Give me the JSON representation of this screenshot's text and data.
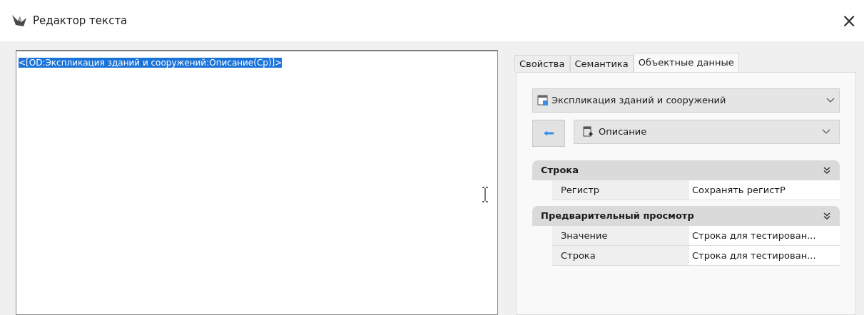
{
  "window": {
    "title": "Редактор текста",
    "close": "×"
  },
  "editor": {
    "text": "<[OD:Экспликация зданий и сооружений:Описание(Ср)]>",
    "selected": true
  },
  "tabs": [
    {
      "label": "Свойства",
      "selected": false
    },
    {
      "label": "Семантика",
      "selected": false
    },
    {
      "label": "Объектные данные",
      "selected": true
    }
  ],
  "table_combo": {
    "value": "Экспликация зданий и сооружений"
  },
  "field_combo": {
    "value": "Описание"
  },
  "groups": [
    {
      "title": "Строка",
      "expanded": true,
      "rows": [
        {
          "name": "Регистр",
          "value": "Сохранять регистР"
        }
      ]
    },
    {
      "title": "Предварительный просмотр",
      "expanded": true,
      "rows": [
        {
          "name": "Значение",
          "value": "Строка для тестирован..."
        },
        {
          "name": "Строка",
          "value": "Строка для тестирован..."
        }
      ]
    }
  ]
}
